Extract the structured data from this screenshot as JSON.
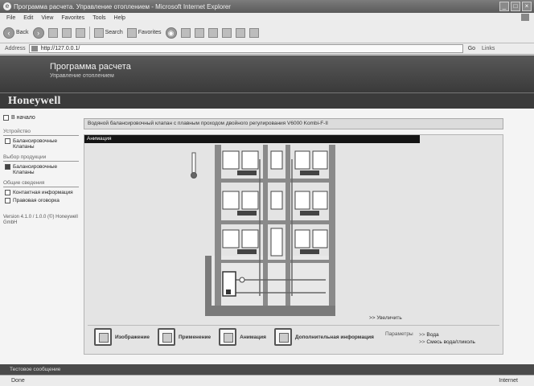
{
  "window": {
    "title": "Программа расчета. Управление отоплением - Microsoft Internet Explorer"
  },
  "menu": [
    "File",
    "Edit",
    "View",
    "Favorites",
    "Tools",
    "Help"
  ],
  "toolbar": {
    "back": "Back",
    "search": "Search",
    "favorites": "Favorites"
  },
  "address": {
    "label": "Address",
    "url": "http://127.0.0.1/",
    "go": "Go",
    "links": "Links"
  },
  "header": {
    "title": "Программа расчета",
    "subtitle": "Управление отоплением",
    "brand": "Honeywell"
  },
  "sidebar": {
    "home": "В начало",
    "groups": [
      {
        "title": "Устройство",
        "items": [
          {
            "label": "Балансировочные Клапаны",
            "checked": false
          }
        ]
      },
      {
        "title": "Выбор продукции",
        "items": [
          {
            "label": "Балансировочные Клапаны",
            "checked": true
          }
        ]
      },
      {
        "title": "Общие сведения",
        "items": [
          {
            "label": "Контактная информация",
            "checked": false
          },
          {
            "label": "Правовая оговорка",
            "checked": false
          }
        ]
      }
    ],
    "version": "Version 4.1.0 / 1.0.0 (©) Honeywell GmbH"
  },
  "main": {
    "breadcrumb": "Водяной балансировочный клапан с плавным проходом двойного регулирования V6000 Kombi-F-II",
    "panel_title": "Анимация",
    "enlarge": ">> Увеличить",
    "tools": [
      "Изображение",
      "Применение",
      "Анимация",
      "Дополнительная информация"
    ],
    "params_label": "Параметры",
    "params_links": [
      "Вода",
      "Смесь вода/гликоль"
    ]
  },
  "status": {
    "bar_top": "Тестовое сообщение",
    "left": "Done",
    "zone": "Internet"
  }
}
